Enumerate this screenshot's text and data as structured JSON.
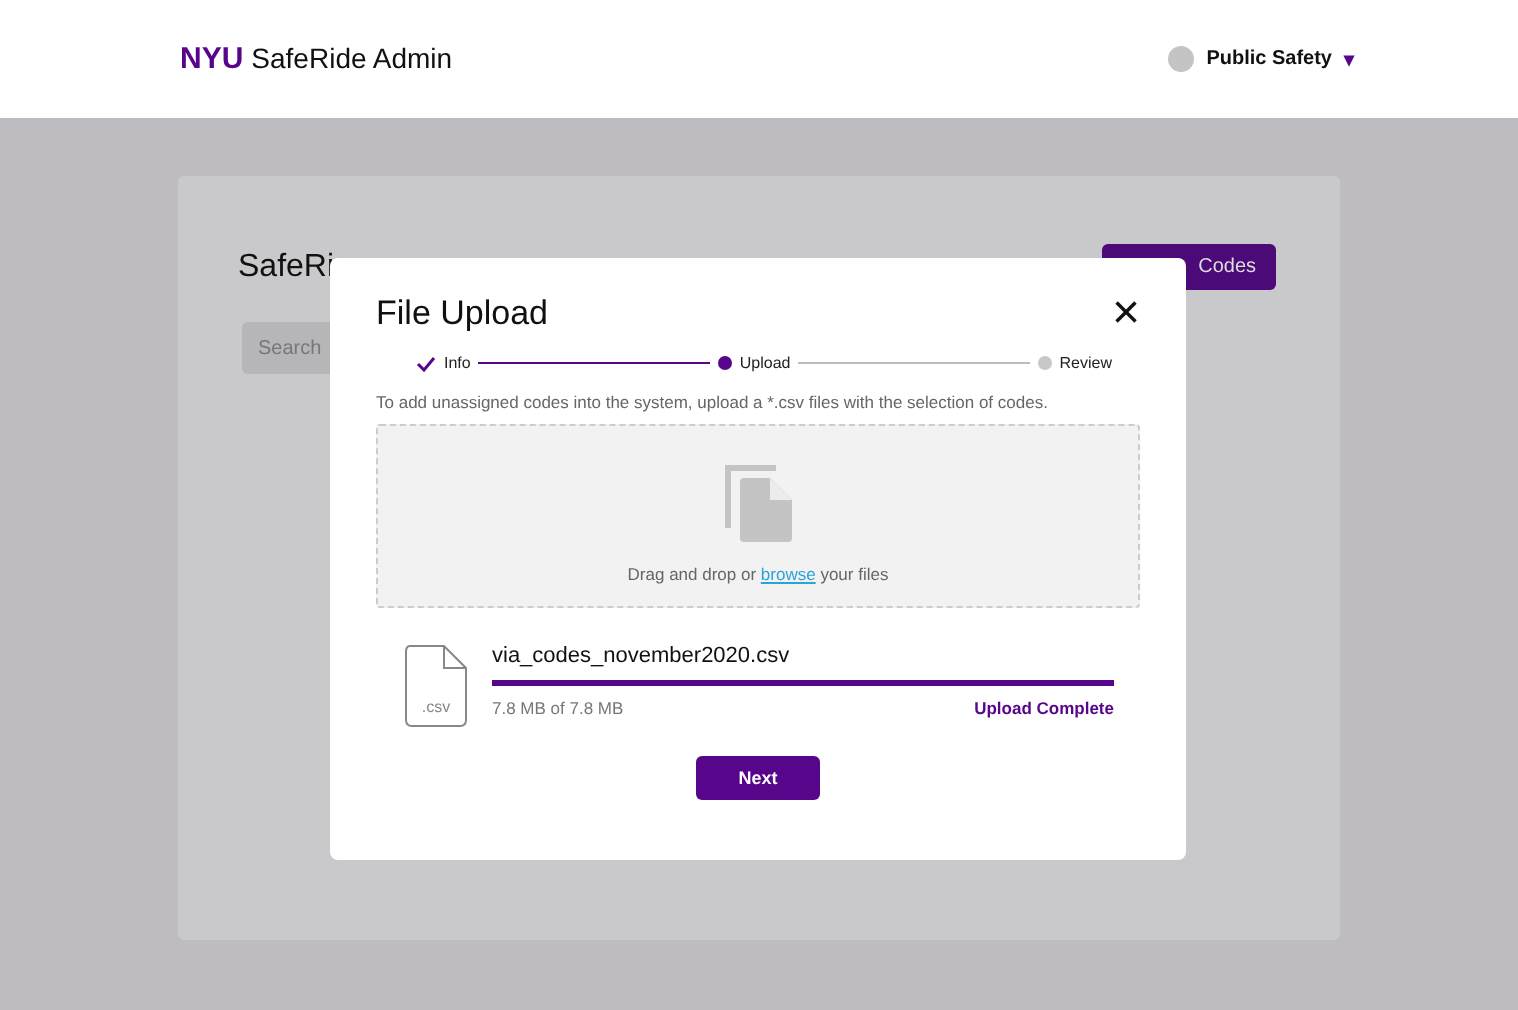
{
  "header": {
    "brand": "NYU",
    "title": "SafeRide Admin",
    "user": {
      "name": "Public Safety",
      "menu_icon": "▾"
    }
  },
  "page": {
    "title": "SafeRi",
    "search": {
      "placeholder": "Search"
    },
    "upload_button": "Codes"
  },
  "modal": {
    "title": "File Upload",
    "close": "×",
    "steps": [
      {
        "label": "Info",
        "kind": "done"
      },
      {
        "label": "Upload",
        "kind": "current"
      },
      {
        "label": "Review",
        "kind": "pending"
      }
    ],
    "instructions": "To add unassigned codes into the system, upload a *.csv files with the selection of codes.",
    "dropzone": {
      "text_before": "Drag and drop or ",
      "link": "browse",
      "text_after": " your files"
    },
    "file": {
      "icon_label": ".csv",
      "name": "via_codes_november2020.csv",
      "level": 1,
      "size": "7.8 MB of 7.8 MB",
      "status": "Upload Complete"
    },
    "next_button": "Next"
  }
}
